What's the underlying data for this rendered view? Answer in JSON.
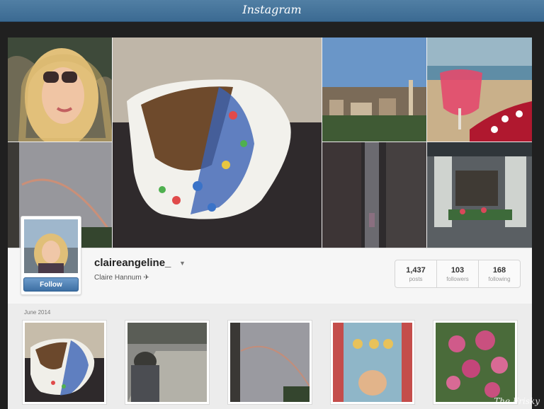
{
  "app": {
    "title": "Instagram"
  },
  "profile": {
    "username": "claireangeline_",
    "full_name": "Claire Hannum ✈︎",
    "follow_label": "Follow",
    "stats": [
      {
        "count": "1,437",
        "label": "posts"
      },
      {
        "count": "103",
        "label": "followers"
      },
      {
        "count": "168",
        "label": "following"
      }
    ]
  },
  "feed": {
    "month_label": "June 2014"
  },
  "watermark": "The Frisky",
  "colors": {
    "header": "#3f6f97",
    "follow_button": "#4a7db0"
  },
  "icons": {
    "caret": "chevron-down-icon"
  }
}
